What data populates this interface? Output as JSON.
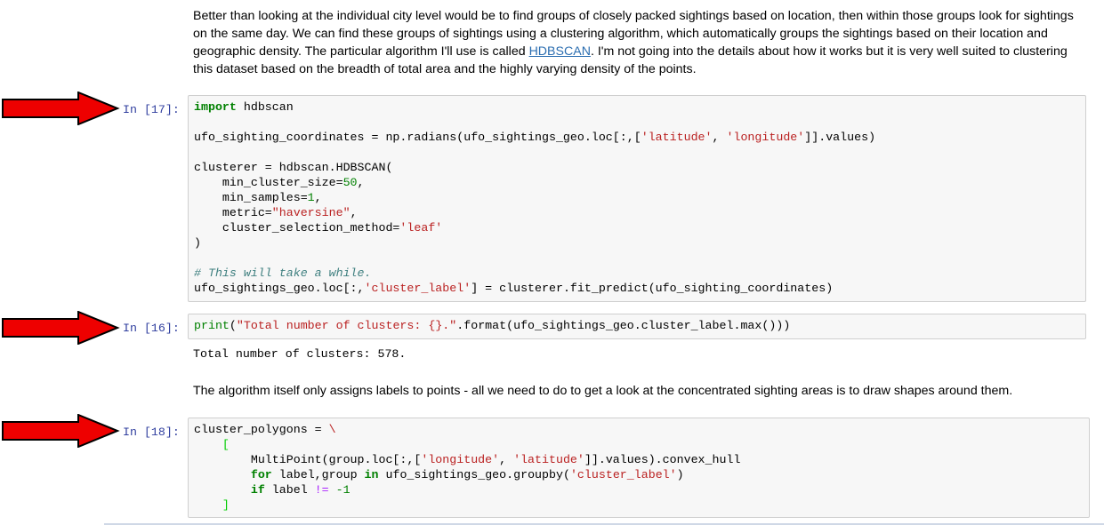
{
  "markdown_top": {
    "text_before_link": "Better than looking at the individual city level would be to find groups of closely packed sightings based on location, then within those groups look for sightings on the same day. We can find these groups of sightings using a clustering algorithm, which automatically groups the sightings based on their location and geographic density. The particular algorithm I'll use is called ",
    "link_text": "HDBSCAN",
    "text_after_link": ". I'm not going into the details about how it works but it is very well suited to clustering this dataset based on the breadth of total area and the highly varying density of the points."
  },
  "cells": [
    {
      "prompt": "In [17]:",
      "code": {
        "l1_kw": "import",
        "l1_mod": " hdbscan",
        "l3_a": "ufo_sighting_coordinates = np.radians(ufo_sightings_geo.loc[:,[",
        "l3_s1": "'latitude'",
        "l3_b": ", ",
        "l3_s2": "'longitude'",
        "l3_c": "]].values)",
        "l5": "clusterer = hdbscan.HDBSCAN(",
        "l6_a": "    min_cluster_size=",
        "l6_n": "50",
        "l6_b": ",",
        "l7_a": "    min_samples=",
        "l7_n": "1",
        "l7_b": ",",
        "l8_a": "    metric=",
        "l8_s": "\"haversine\"",
        "l8_b": ",",
        "l9_a": "    cluster_selection_method=",
        "l9_s": "'leaf'",
        "l10": ")",
        "l12": "# This will take a while.",
        "l13_a": "ufo_sightings_geo.loc[:,",
        "l13_s": "'cluster_label'",
        "l13_b": "] = clusterer.fit_predict(ufo_sighting_coordinates)"
      }
    },
    {
      "prompt": "In [16]:",
      "code": {
        "fn": "print",
        "a": "(",
        "s": "\"Total number of clusters: {}.\"",
        "b": ".format(ufo_sightings_geo.cluster_label.max()))"
      },
      "output": "Total number of clusters: 578."
    },
    {
      "prompt": "In [18]:",
      "code": {
        "l1_a": "cluster_polygons = ",
        "l1_op": "\\",
        "l2": "[",
        "l3_a": "        MultiPoint(group.loc[:,[",
        "l3_s1": "'longitude'",
        "l3_b": ", ",
        "l3_s2": "'latitude'",
        "l3_c": "]].values).convex_hull",
        "l4_kw": "for",
        "l4_a": " label,group ",
        "l4_kw2": "in",
        "l4_b": " ufo_sightings_geo.groupby(",
        "l4_s": "'cluster_label'",
        "l4_c": ")",
        "l5_kw": "if",
        "l5_a": " label ",
        "l5_op": "!=",
        "l5_b": " ",
        "l5_n": "-1",
        "l6": "]"
      }
    }
  ],
  "markdown_mid": "The algorithm itself only assigns labels to points - all we need to do to get a look at the concentrated sighting areas is to draw shapes around them.",
  "colors": {
    "arrow_fill": "#ee0000",
    "prompt": "#303f9f",
    "cell_bg": "#f7f7f7"
  }
}
